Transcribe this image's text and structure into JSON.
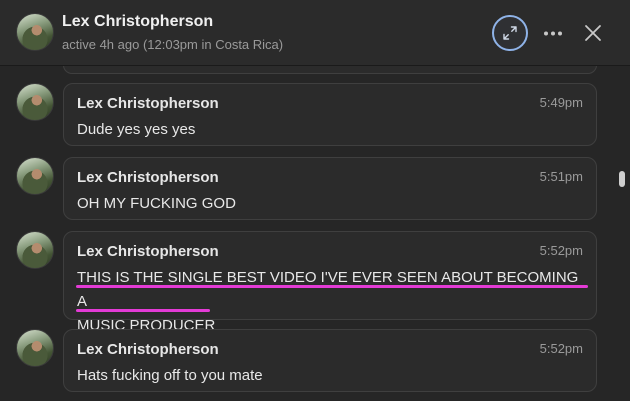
{
  "header": {
    "name": "Lex Christopherson",
    "status": "active 4h ago (12:03pm in Costa Rica)",
    "expand_icon": "expand-arrows-icon",
    "more_icon": "more-horizontal-icon",
    "close_icon": "close-icon"
  },
  "messages": [
    {
      "author": "Lex Christopherson",
      "time": "5:49pm",
      "text": "Dude yes yes yes"
    },
    {
      "author": "Lex Christopherson",
      "time": "5:51pm",
      "text": "OH MY FUCKING GOD"
    },
    {
      "author": "Lex Christopherson",
      "time": "5:52pm",
      "text_line1": "THIS IS THE SINGLE BEST VIDEO I'VE EVER SEEN ABOUT BECOMING A",
      "text_line2": "MUSIC PRODUCER"
    },
    {
      "author": "Lex Christopherson",
      "time": "5:52pm",
      "text": "Hats fucking off to you mate"
    }
  ],
  "colors": {
    "highlight": "#e43bd6",
    "focus_ring": "#8fb3e8",
    "background": "#262626"
  }
}
